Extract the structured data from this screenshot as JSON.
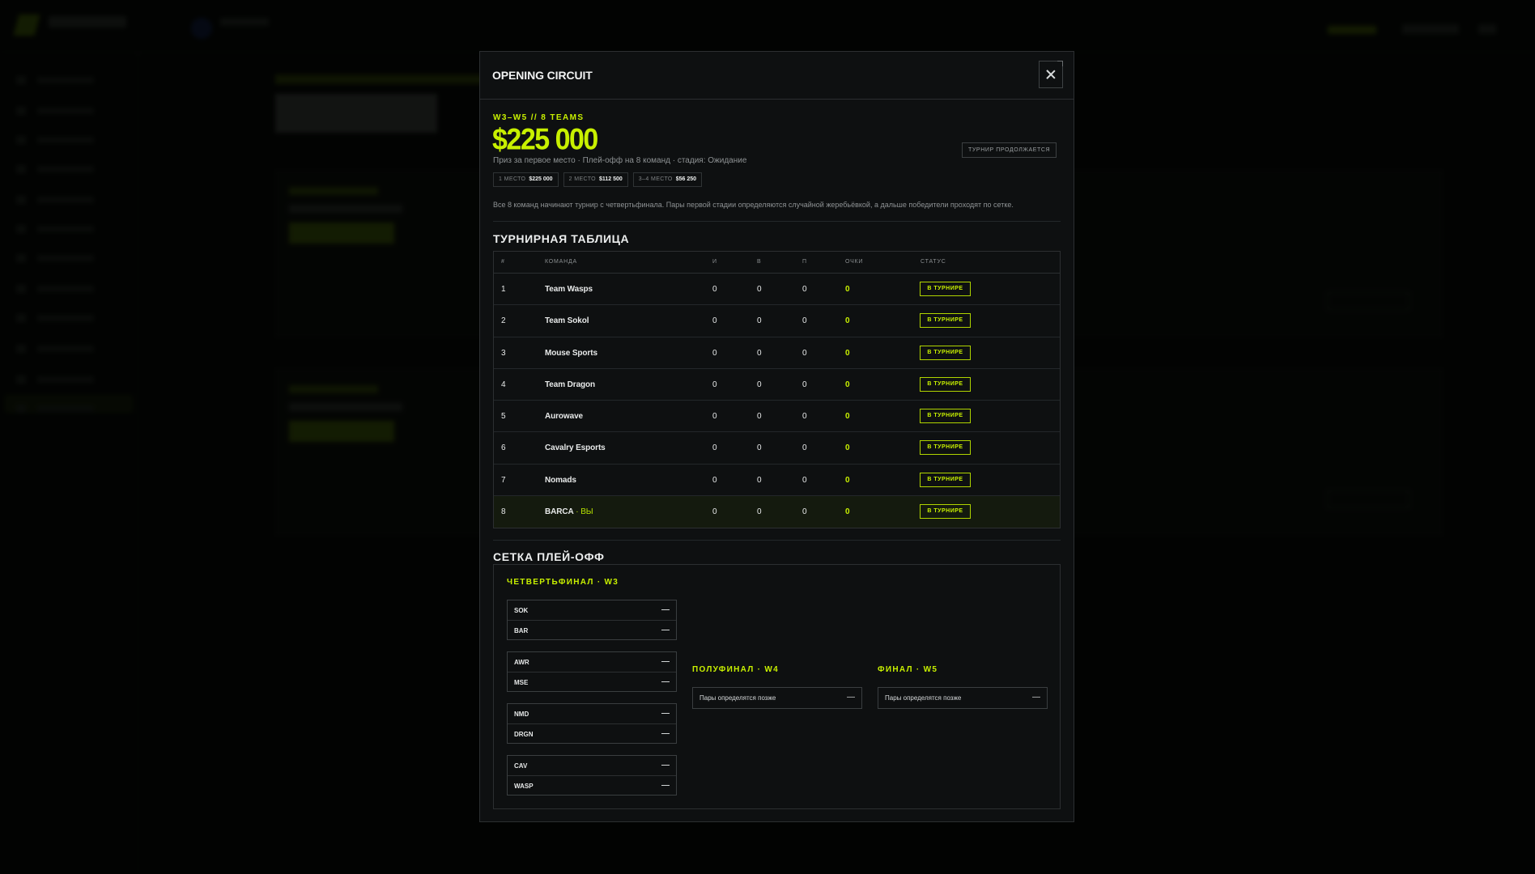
{
  "modal": {
    "title": "OPENING CIRCUIT",
    "kicker": "W3–W5 // 8 TEAMS",
    "prize": "$225 000",
    "subtitle": "Приз за первое место · Плей-офф на 8 команд · стадия: Ожидание",
    "status": "ТУРНИР ПРОДОЛЖАЕТСЯ",
    "prize_chips": [
      {
        "label": "1 МЕСТО",
        "value": "$225 000"
      },
      {
        "label": "2 МЕСТО",
        "value": "$112 500"
      },
      {
        "label": "3–4 МЕСТО",
        "value": "$56 250"
      }
    ],
    "description": "Все 8 команд начинают турнир с четвертьфинала. Пары первой стадии определяются случайной жеребьёвкой, а дальше победители проходят по сетке."
  },
  "standings": {
    "title": "ТУРНИРНАЯ ТАБЛИЦА",
    "columns": [
      "#",
      "КОМАНДА",
      "И",
      "В",
      "П",
      "ОЧКИ",
      "СТАТУС"
    ],
    "rows": [
      {
        "pos": "1",
        "team": "Team Wasps",
        "you": "",
        "played": "0",
        "won": "0",
        "lost": "0",
        "points": "0",
        "status": "В ТУРНИРЕ"
      },
      {
        "pos": "2",
        "team": "Team Sokol",
        "you": "",
        "played": "0",
        "won": "0",
        "lost": "0",
        "points": "0",
        "status": "В ТУРНИРЕ"
      },
      {
        "pos": "3",
        "team": "Mouse Sports",
        "you": "",
        "played": "0",
        "won": "0",
        "lost": "0",
        "points": "0",
        "status": "В ТУРНИРЕ"
      },
      {
        "pos": "4",
        "team": "Team Dragon",
        "you": "",
        "played": "0",
        "won": "0",
        "lost": "0",
        "points": "0",
        "status": "В ТУРНИРЕ"
      },
      {
        "pos": "5",
        "team": "Aurowave",
        "you": "",
        "played": "0",
        "won": "0",
        "lost": "0",
        "points": "0",
        "status": "В ТУРНИРЕ"
      },
      {
        "pos": "6",
        "team": "Cavalry Esports",
        "you": "",
        "played": "0",
        "won": "0",
        "lost": "0",
        "points": "0",
        "status": "В ТУРНИРЕ"
      },
      {
        "pos": "7",
        "team": "Nomads",
        "you": "",
        "played": "0",
        "won": "0",
        "lost": "0",
        "points": "0",
        "status": "В ТУРНИРЕ"
      },
      {
        "pos": "8",
        "team": "BARCA",
        "you": " · ВЫ",
        "played": "0",
        "won": "0",
        "lost": "0",
        "points": "0",
        "status": "В ТУРНИРЕ"
      }
    ]
  },
  "bracket": {
    "title": "СЕТКА ПЛЕЙ-ОФФ",
    "quarterfinal": {
      "title": "ЧЕТВЕРТЬФИНАЛ · W3",
      "matches": [
        {
          "a": "SOK",
          "a_score": "—",
          "b": "BAR",
          "b_score": "—"
        },
        {
          "a": "AWR",
          "a_score": "—",
          "b": "MSE",
          "b_score": "—"
        },
        {
          "a": "NMD",
          "a_score": "—",
          "b": "DRGN",
          "b_score": "—"
        },
        {
          "a": "CAV",
          "a_score": "—",
          "b": "WASP",
          "b_score": "—"
        }
      ]
    },
    "semifinal": {
      "title": "ПОЛУФИНАЛ · W4",
      "placeholder": "Пары определятся позже",
      "score": "—"
    },
    "final": {
      "title": "ФИНАЛ · W5",
      "placeholder": "Пары определятся позже",
      "score": "—"
    }
  },
  "colors": {
    "accent": "#c8f000",
    "surface": "#0e1011",
    "border": "#2c2f31"
  }
}
